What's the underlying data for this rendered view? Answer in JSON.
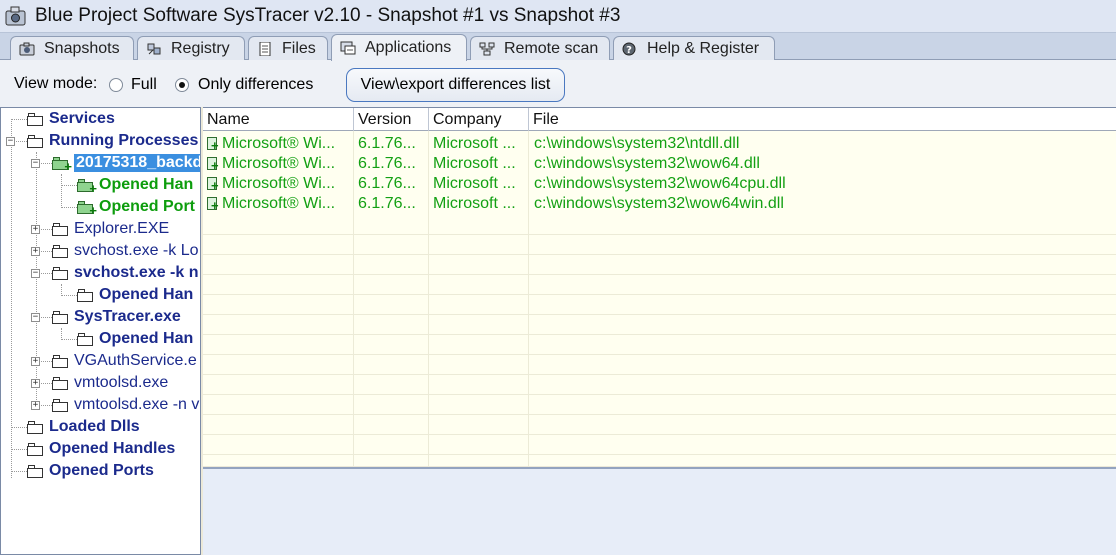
{
  "window": {
    "title": "Blue Project Software SysTracer v2.10 - Snapshot #1 vs Snapshot #3"
  },
  "tabs": [
    {
      "label": "Snapshots",
      "icon": "camera-icon"
    },
    {
      "label": "Registry",
      "icon": "registry-icon"
    },
    {
      "label": "Files",
      "icon": "file-icon"
    },
    {
      "label": "Applications",
      "icon": "applications-icon",
      "active": true
    },
    {
      "label": "Remote scan",
      "icon": "network-icon"
    },
    {
      "label": "Help & Register",
      "icon": "help-icon"
    }
  ],
  "toolbar": {
    "view_mode_label": "View mode:",
    "full_label": "Full",
    "only_diff_label": "Only differences",
    "selected_mode": "Only differences",
    "export_button": "View\\export differences list"
  },
  "tree": {
    "services": "Services",
    "running_processes": "Running Processes",
    "backdoor": "20175318_backd",
    "opened_handles_1": "Opened Han",
    "opened_ports_1": "Opened Port",
    "explorer": "Explorer.EXE",
    "svchost1": "svchost.exe -k Lo",
    "svchost2": "svchost.exe -k n",
    "opened_handles_2": "Opened Han",
    "systracer": "SysTracer.exe",
    "opened_handles_3": "Opened Han",
    "vgauth": "VGAuthService.e",
    "vmtoolsd": "vmtoolsd.exe",
    "vmtoolsd_n": "vmtoolsd.exe -n v",
    "loaded_dlls": "Loaded Dlls",
    "opened_handles": "Opened Handles",
    "opened_ports": "Opened Ports"
  },
  "list": {
    "columns": [
      "Name",
      "Version",
      "Company",
      "File"
    ],
    "rows": [
      {
        "name": "Microsoft® Wi...",
        "version": "6.1.76...",
        "company": "Microsoft ...",
        "file": "c:\\windows\\system32\\ntdll.dll"
      },
      {
        "name": "Microsoft® Wi...",
        "version": "6.1.76...",
        "company": "Microsoft ...",
        "file": "c:\\windows\\system32\\wow64.dll"
      },
      {
        "name": "Microsoft® Wi...",
        "version": "6.1.76...",
        "company": "Microsoft ...",
        "file": "c:\\windows\\system32\\wow64cpu.dll"
      },
      {
        "name": "Microsoft® Wi...",
        "version": "6.1.76...",
        "company": "Microsoft ...",
        "file": "c:\\windows\\system32\\wow64win.dll"
      }
    ]
  },
  "colors": {
    "added_text": "#13a013",
    "tree_bold_text": "#1b2a8c",
    "selection": "#3b8fe0"
  }
}
